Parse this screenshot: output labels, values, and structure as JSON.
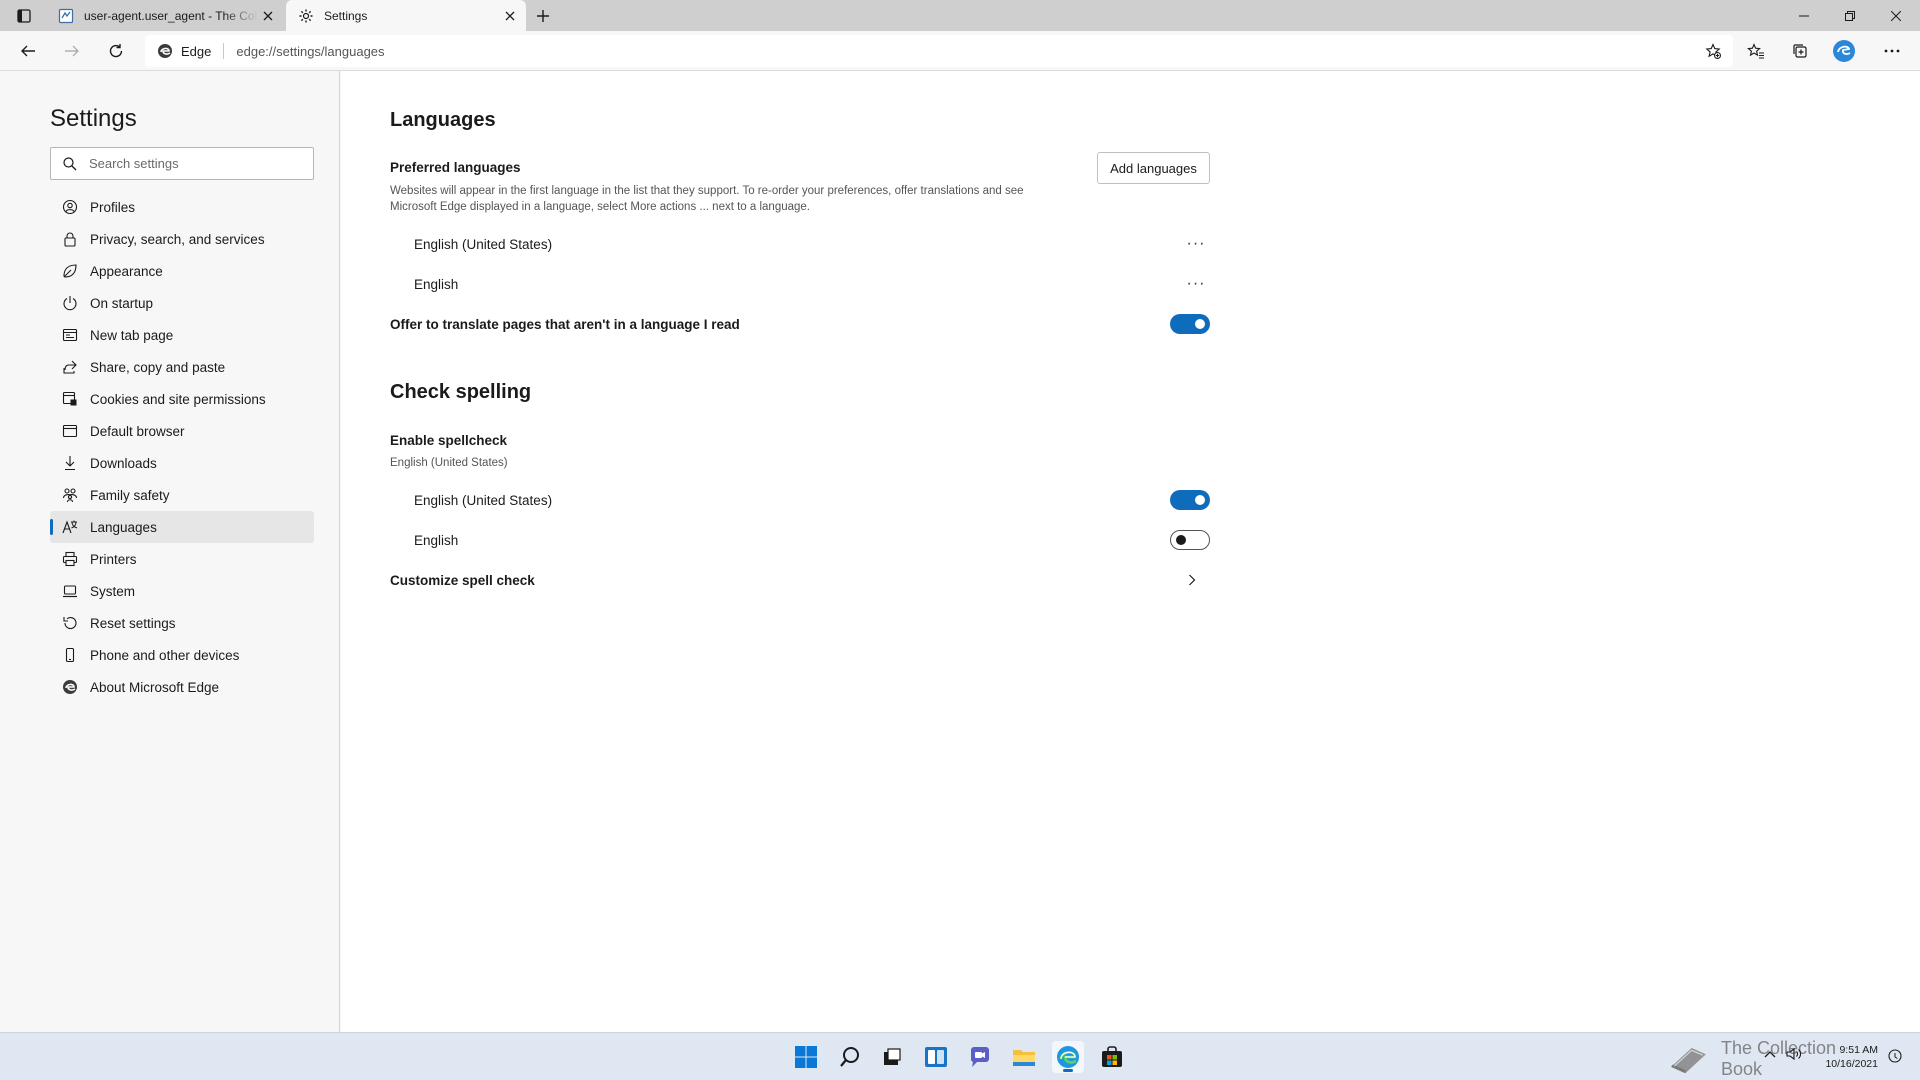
{
  "tabs": [
    {
      "title": "user-agent.user_agent - The Collection Book",
      "icon": "document-favicon-icon"
    },
    {
      "title": "Settings",
      "icon": "gear-icon"
    }
  ],
  "toolbar": {
    "site_label": "Edge",
    "url": "edge://settings/languages"
  },
  "sidebar": {
    "title": "Settings",
    "search_placeholder": "Search settings",
    "items": [
      {
        "label": "Profiles",
        "icon": "profile-icon"
      },
      {
        "label": "Privacy, search, and services",
        "icon": "lock-icon"
      },
      {
        "label": "Appearance",
        "icon": "appearance-icon"
      },
      {
        "label": "On startup",
        "icon": "power-icon"
      },
      {
        "label": "New tab page",
        "icon": "newtab-icon"
      },
      {
        "label": "Share, copy and paste",
        "icon": "share-icon"
      },
      {
        "label": "Cookies and site permissions",
        "icon": "cookies-icon"
      },
      {
        "label": "Default browser",
        "icon": "browser-icon"
      },
      {
        "label": "Downloads",
        "icon": "download-icon"
      },
      {
        "label": "Family safety",
        "icon": "family-icon"
      },
      {
        "label": "Languages",
        "icon": "languages-icon"
      },
      {
        "label": "Printers",
        "icon": "printer-icon"
      },
      {
        "label": "System",
        "icon": "laptop-icon"
      },
      {
        "label": "Reset settings",
        "icon": "reset-icon"
      },
      {
        "label": "Phone and other devices",
        "icon": "phone-icon"
      },
      {
        "label": "About Microsoft Edge",
        "icon": "edge-logo-icon"
      }
    ],
    "active_item": "Languages"
  },
  "main": {
    "title": "Languages",
    "preferred": {
      "title": "Preferred languages",
      "description": "Websites will appear in the first language in the list that they support. To re-order your preferences, offer translations and see Microsoft Edge displayed in a language, select More actions ... next to a language.",
      "add_button": "Add languages",
      "languages": [
        "English (United States)",
        "English"
      ],
      "more_label": "···"
    },
    "translate": {
      "label": "Offer to translate pages that aren't in a language I read",
      "enabled": true
    },
    "spelling": {
      "title": "Check spelling",
      "enable_title": "Enable spellcheck",
      "enable_sub": "English (United States)",
      "languages": [
        {
          "label": "English (United States)",
          "enabled": true
        },
        {
          "label": "English",
          "enabled": false
        }
      ],
      "customize_label": "Customize spell check"
    }
  },
  "taskbar": {
    "apps": [
      "start-icon",
      "search-icon",
      "task-view-icon",
      "widgets-icon",
      "chat-icon",
      "file-explorer-icon",
      "edge-icon",
      "store-icon"
    ],
    "active_app": "edge-icon",
    "watermark": "The Collection Book",
    "time": "9:51 AM",
    "date": "10/16/2021"
  },
  "colors": {
    "accent": "#0f6cbd",
    "taskbar": "#dfe7f3"
  }
}
